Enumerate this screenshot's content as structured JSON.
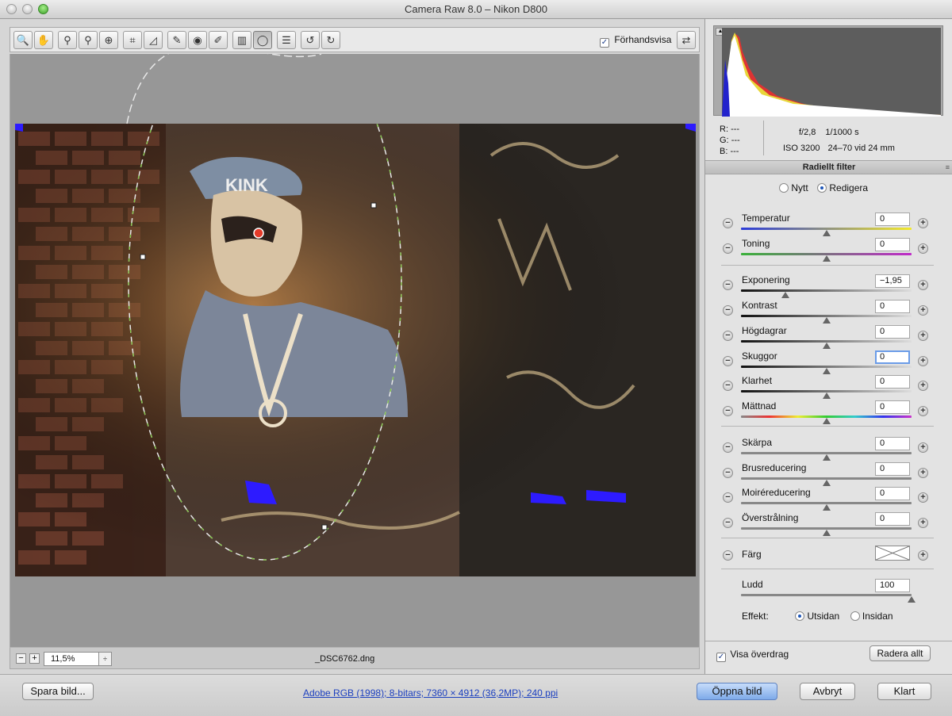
{
  "window": {
    "title": "Camera Raw 8.0  –  Nikon D800"
  },
  "toolbar": {
    "tools": [
      {
        "icon": "zoom-icon",
        "glyph": "🔍"
      },
      {
        "icon": "hand-icon",
        "glyph": "✋"
      },
      {
        "icon": "white-balance-icon",
        "glyph": "⚲"
      },
      {
        "icon": "color-sampler-icon",
        "glyph": "⚲"
      },
      {
        "icon": "targeted-adjustment-icon",
        "glyph": "⊕"
      },
      {
        "icon": "crop-icon",
        "glyph": "⌗"
      },
      {
        "icon": "straighten-icon",
        "glyph": "◿"
      },
      {
        "icon": "spot-removal-icon",
        "glyph": "✎"
      },
      {
        "icon": "red-eye-icon",
        "glyph": "◉"
      },
      {
        "icon": "adjustment-brush-icon",
        "glyph": "✐"
      },
      {
        "icon": "graduated-filter-icon",
        "glyph": "▥"
      },
      {
        "icon": "radial-filter-icon",
        "glyph": "◯"
      },
      {
        "icon": "preferences-icon",
        "glyph": "☰"
      },
      {
        "icon": "rotate-ccw-icon",
        "glyph": "↺"
      },
      {
        "icon": "rotate-cw-icon",
        "glyph": "↻"
      }
    ],
    "preview_label": "Förhandsvisa",
    "preview_checked": true,
    "fullscreen_icon": "fullscreen-icon"
  },
  "status": {
    "zoom": "11,5%",
    "filename": "_DSC6762.dng",
    "zoom_out": "−",
    "zoom_in": "+",
    "zoom_step": "÷"
  },
  "info": {
    "r_label": "R:",
    "r_value": "---",
    "g_label": "G:",
    "g_value": "---",
    "b_label": "B:",
    "b_value": "---",
    "aperture": "f/2,8",
    "shutter": "1/1000 s",
    "iso": "ISO 3200",
    "lens": "24–70 vid 24 mm"
  },
  "panel": {
    "title": "Radiellt filter",
    "mode_new": "Nytt",
    "mode_edit": "Redigera",
    "mode_selected": "Redigera",
    "sliders": [
      {
        "label": "Temperatur",
        "value": "0",
        "level": 0.5
      },
      {
        "label": "Toning",
        "value": "0",
        "level": 0.5
      },
      {
        "label": "Exponering",
        "value": "−1,95",
        "level": 0.26
      },
      {
        "label": "Kontrast",
        "value": "0",
        "level": 0.5
      },
      {
        "label": "Högdagrar",
        "value": "0",
        "level": 0.5
      },
      {
        "label": "Skuggor",
        "value": "0",
        "level": 0.5
      },
      {
        "label": "Klarhet",
        "value": "0",
        "level": 0.5
      },
      {
        "label": "Mättnad",
        "value": "0",
        "level": 0.5
      },
      {
        "label": "Skärpa",
        "value": "0",
        "level": 0.5
      },
      {
        "label": "Brusreducering",
        "value": "0",
        "level": 0.5
      },
      {
        "label": "Moiréreducering",
        "value": "0",
        "level": 0.5
      },
      {
        "label": "Överstrålning",
        "value": "0",
        "level": 0.5
      }
    ],
    "color_label": "Färg",
    "feather_label": "Ludd",
    "feather_value": "100",
    "feather_level": 1.0,
    "effect_label": "Effekt:",
    "effect_outside": "Utsidan",
    "effect_inside": "Insidan",
    "effect_selected": "Utsidan",
    "show_overlay_label": "Visa överdrag",
    "show_overlay_checked": true,
    "clear_all": "Radera allt"
  },
  "colors": {
    "track_temp_start": "#2b3bd9",
    "track_temp_end": "#f3e92a",
    "track_tint_start": "#3ab23a",
    "track_tint_end": "#c02ac9",
    "primary_button": "#7eaae9",
    "link": "#1b3fbf"
  },
  "footer": {
    "save": "Spara bild...",
    "workflow": "Adobe RGB (1998); 8-bitars; 7360 × 4912 (36,2MP); 240 ppi",
    "open": "Öppna bild",
    "cancel": "Avbryt",
    "done": "Klart"
  }
}
